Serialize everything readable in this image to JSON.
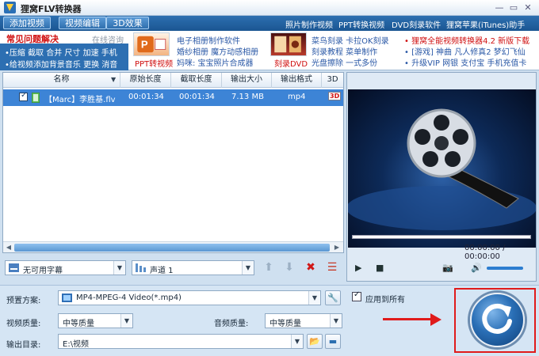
{
  "window": {
    "title": "狸窝FLV转换器"
  },
  "toolbar": {
    "add_video": "添加视频",
    "edit_video": "视频编辑",
    "effect_3d": "3D效果",
    "links": [
      "照片制作视频",
      "PPT转换视频",
      "DVD刻录软件",
      "狸窝苹果(iTunes)助手"
    ]
  },
  "faq": {
    "title": "常见问题解决",
    "online": "在线咨询",
    "line1": "•压缩 截取 合并 尺寸 加速 手机",
    "line2": "•给视频添加背景音乐 更换 消音"
  },
  "ads": {
    "ppt_caption": "PPT转视频",
    "col1": [
      "电子相册制作软件",
      "婚纱相册 魔方动感相册",
      "妈咪: 宝宝照片合成器"
    ],
    "dvd_caption": "刻录DVD",
    "col2": [
      "菜鸟刻录 卡拉OK刻录",
      "刻录教程 菜单制作",
      "光盘擦除 一式多份"
    ],
    "col3_line1": "• 狸窝全能视频转换器4.2 新版下载",
    "col3_line2": "• [游戏] 神曲 凡人修真2 梦幻飞仙",
    "col3_line3": "• 升级VIP 网银 支付宝 手机充值卡"
  },
  "table": {
    "columns": [
      "名称",
      "原始长度",
      "截取长度",
      "输出大小",
      "输出格式",
      "3D"
    ],
    "rows": [
      {
        "name": "【Marc】李胜基.flv",
        "orig": "00:01:34",
        "clip": "00:01:34",
        "size": "7.13 MB",
        "format": "mp4",
        "badge": "3D"
      }
    ]
  },
  "player": {
    "time": "00:00:00 / 00:00:00",
    "volume": 0.85
  },
  "subtitle": {
    "value": "无可用字幕"
  },
  "audio_track": {
    "value": "声道 1"
  },
  "settings": {
    "preset_label": "预置方案:",
    "preset_value": "MP4-MPEG-4 Video(*.mp4)",
    "apply_all": "应用到所有",
    "video_quality_label": "视频质量:",
    "video_quality_value": "中等质量",
    "audio_quality_label": "音频质量:",
    "audio_quality_value": "中等质量",
    "output_label": "输出目录:",
    "output_value": "E:\\视频"
  },
  "colors": {
    "accent": "#2c6fb0",
    "highlight": "#e01b1b"
  }
}
